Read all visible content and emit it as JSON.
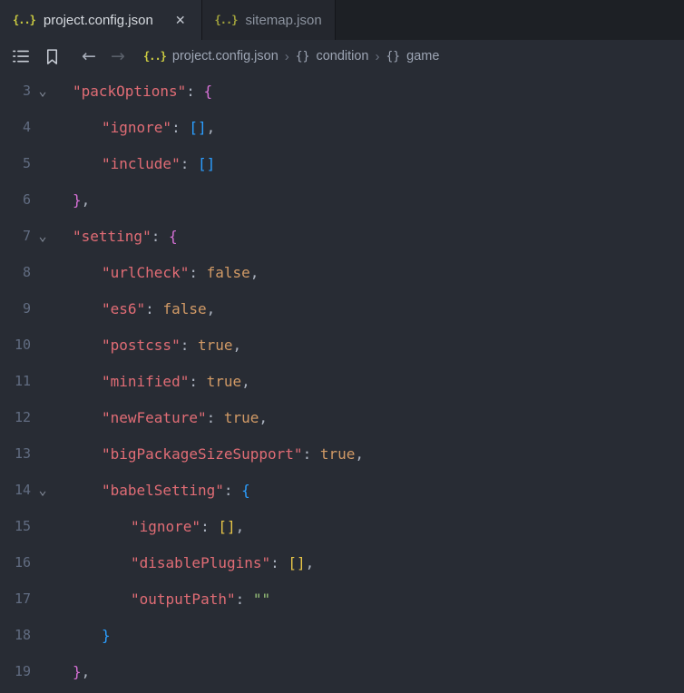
{
  "window": {
    "tabs": [
      {
        "icon": "{..}",
        "label": "project.config.json",
        "close_label": "✕",
        "active": true
      },
      {
        "icon": "{..}",
        "label": "sitemap.json",
        "active": false
      }
    ]
  },
  "toolbar": {
    "back": "←",
    "forward": "→"
  },
  "breadcrumbs": {
    "file_icon": "{..}",
    "file": "project.config.json",
    "separator": "›",
    "symbol_icon": "{}",
    "items": [
      "condition",
      "game"
    ]
  },
  "editor": {
    "fold_icon": "⌄",
    "lines": [
      {
        "num": 3,
        "fold": true,
        "indent": 1,
        "tokens": [
          [
            "\"packOptions\"",
            "key"
          ],
          [
            ": ",
            "punct"
          ],
          [
            "{",
            "b2"
          ]
        ]
      },
      {
        "num": 4,
        "fold": false,
        "indent": 2,
        "tokens": [
          [
            "\"ignore\"",
            "key"
          ],
          [
            ": ",
            "punct"
          ],
          [
            "[]",
            "b3"
          ],
          [
            ",",
            "punct"
          ]
        ]
      },
      {
        "num": 5,
        "fold": false,
        "indent": 2,
        "tokens": [
          [
            "\"include\"",
            "key"
          ],
          [
            ": ",
            "punct"
          ],
          [
            "[]",
            "b3"
          ]
        ]
      },
      {
        "num": 6,
        "fold": false,
        "indent": 1,
        "tokens": [
          [
            "}",
            "b2"
          ],
          [
            ",",
            "punct"
          ]
        ]
      },
      {
        "num": 7,
        "fold": true,
        "indent": 1,
        "tokens": [
          [
            "\"setting\"",
            "key"
          ],
          [
            ": ",
            "punct"
          ],
          [
            "{",
            "b2"
          ]
        ]
      },
      {
        "num": 8,
        "fold": false,
        "indent": 2,
        "tokens": [
          [
            "\"urlCheck\"",
            "key"
          ],
          [
            ": ",
            "punct"
          ],
          [
            "false",
            "bool"
          ],
          [
            ",",
            "punct"
          ]
        ]
      },
      {
        "num": 9,
        "fold": false,
        "indent": 2,
        "tokens": [
          [
            "\"es6\"",
            "key"
          ],
          [
            ": ",
            "punct"
          ],
          [
            "false",
            "bool"
          ],
          [
            ",",
            "punct"
          ]
        ]
      },
      {
        "num": 10,
        "fold": false,
        "indent": 2,
        "tokens": [
          [
            "\"postcss\"",
            "key"
          ],
          [
            ": ",
            "punct"
          ],
          [
            "true",
            "bool"
          ],
          [
            ",",
            "punct"
          ]
        ]
      },
      {
        "num": 11,
        "fold": false,
        "indent": 2,
        "tokens": [
          [
            "\"minified\"",
            "key"
          ],
          [
            ": ",
            "punct"
          ],
          [
            "true",
            "bool"
          ],
          [
            ",",
            "punct"
          ]
        ]
      },
      {
        "num": 12,
        "fold": false,
        "indent": 2,
        "tokens": [
          [
            "\"newFeature\"",
            "key"
          ],
          [
            ": ",
            "punct"
          ],
          [
            "true",
            "bool"
          ],
          [
            ",",
            "punct"
          ]
        ]
      },
      {
        "num": 13,
        "fold": false,
        "indent": 2,
        "tokens": [
          [
            "\"bigPackageSizeSupport\"",
            "key"
          ],
          [
            ": ",
            "punct"
          ],
          [
            "true",
            "bool"
          ],
          [
            ",",
            "punct"
          ]
        ]
      },
      {
        "num": 14,
        "fold": true,
        "indent": 2,
        "tokens": [
          [
            "\"babelSetting\"",
            "key"
          ],
          [
            ": ",
            "punct"
          ],
          [
            "{",
            "b3"
          ]
        ]
      },
      {
        "num": 15,
        "fold": false,
        "indent": 3,
        "tokens": [
          [
            "\"ignore\"",
            "key"
          ],
          [
            ": ",
            "punct"
          ],
          [
            "[]",
            "b1"
          ],
          [
            ",",
            "punct"
          ]
        ]
      },
      {
        "num": 16,
        "fold": false,
        "indent": 3,
        "tokens": [
          [
            "\"disablePlugins\"",
            "key"
          ],
          [
            ": ",
            "punct"
          ],
          [
            "[]",
            "b1"
          ],
          [
            ",",
            "punct"
          ]
        ]
      },
      {
        "num": 17,
        "fold": false,
        "indent": 3,
        "tokens": [
          [
            "\"outputPath\"",
            "key"
          ],
          [
            ": ",
            "punct"
          ],
          [
            "\"\"",
            "str"
          ]
        ]
      },
      {
        "num": 18,
        "fold": false,
        "indent": 2,
        "tokens": [
          [
            "}",
            "b3"
          ]
        ]
      },
      {
        "num": 19,
        "fold": false,
        "indent": 1,
        "tokens": [
          [
            "}",
            "b2"
          ],
          [
            ",",
            "punct"
          ]
        ]
      }
    ]
  },
  "colors": {
    "background": "#282c34",
    "tabbar_background": "#1d2025",
    "key": "#e06c75",
    "punctuation": "#abb2bf",
    "boolean": "#d19a66",
    "string": "#98c379",
    "bracket_gold": "#e7c547",
    "bracket_purple": "#d670d6",
    "bracket_blue": "#2b9eff",
    "line_number": "#616c81",
    "file_icon": "#cbcb41"
  }
}
